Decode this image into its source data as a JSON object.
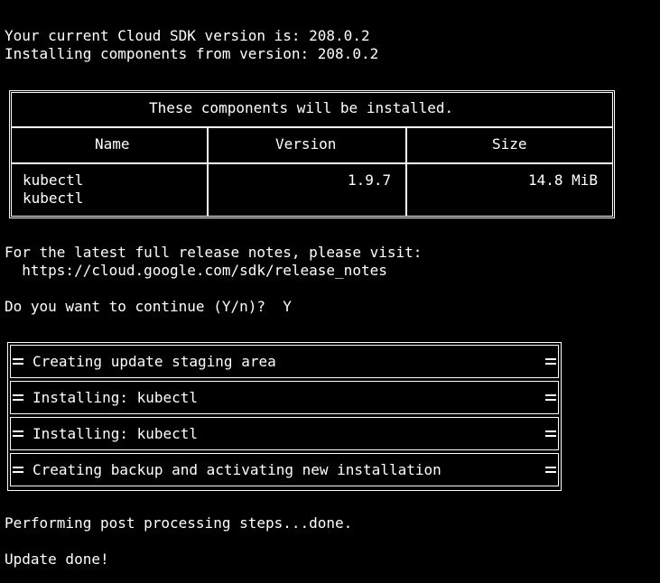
{
  "terminal": {
    "lines": {
      "sdk_version": "Your current Cloud SDK version is: 208.0.2",
      "installing_from": "Installing components from version: 208.0.2",
      "release_notes_intro": "For the latest full release notes, please visit:",
      "release_notes_url": "  https://cloud.google.com/sdk/release_notes",
      "prompt": "Do you want to continue (Y/n)?  Y",
      "post_processing": "Performing post processing steps...done.",
      "update_done": "Update done!"
    },
    "components_table": {
      "title": "These components will be installed.",
      "headers": [
        "Name",
        "Version",
        "Size"
      ],
      "rows": [
        {
          "name_line1": "kubectl",
          "name_line2": "kubectl",
          "version": "1.9.7",
          "size": "14.8 MiB"
        }
      ]
    },
    "progress": [
      "Creating update staging area",
      "Installing: kubectl",
      "Installing: kubectl",
      "Creating backup and activating new installation"
    ]
  }
}
